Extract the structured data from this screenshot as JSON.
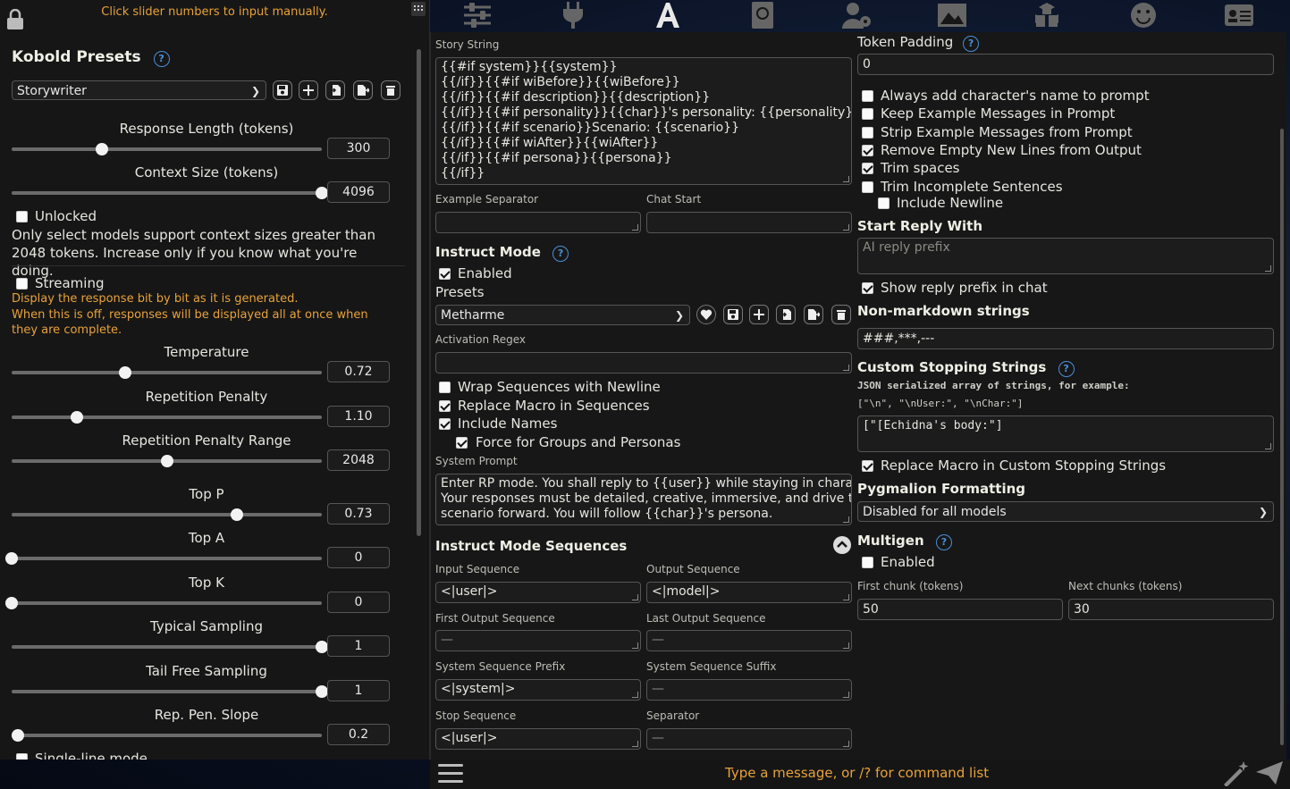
{
  "left": {
    "hint": "Click slider numbers to input manually.",
    "title": "Kobold Presets",
    "help": "?",
    "preset_select": "Storywriter",
    "sliders_top": [
      {
        "label": "Response Length (tokens)",
        "value": "300",
        "fraction": 0.29
      },
      {
        "label": "Context Size (tokens)",
        "value": "4096",
        "fraction": 1.0
      }
    ],
    "unlocked_label": "Unlocked",
    "unlocked_note": "Only select models support context sizes greater than 2048 tokens. Increase only if you know what you're doing.",
    "streaming_label": "Streaming",
    "streaming_note1": "Display the response bit by bit as it is generated.",
    "streaming_note2": "When this is off, responses will be displayed all at once when they are complete.",
    "sliders": [
      {
        "label": "Temperature",
        "value": "0.72",
        "fraction": 0.365
      },
      {
        "label": "Repetition Penalty",
        "value": "1.10",
        "fraction": 0.21
      },
      {
        "label": "Repetition Penalty Range",
        "value": "2048",
        "fraction": 0.5
      },
      {
        "label": "Top P",
        "value": "0.73",
        "fraction": 0.725
      },
      {
        "label": "Top A",
        "value": "0",
        "fraction": 0.0
      },
      {
        "label": "Top K",
        "value": "0",
        "fraction": 0.0
      },
      {
        "label": "Typical Sampling",
        "value": "1",
        "fraction": 1.0
      },
      {
        "label": "Tail Free Sampling",
        "value": "1",
        "fraction": 1.0
      },
      {
        "label": "Rep. Pen. Slope",
        "value": "0.2",
        "fraction": 0.02
      }
    ],
    "cut_label": "Single-line mode"
  },
  "main": {
    "story_string_label": "Story String",
    "story_string": "{{#if system}}{{system}}\n{{/if}}{{#if wiBefore}}{{wiBefore}}\n{{/if}}{{#if description}}{{description}}\n{{/if}}{{#if personality}}{{char}}'s personality: {{personality}}\n{{/if}}{{#if scenario}}Scenario: {{scenario}}\n{{/if}}{{#if wiAfter}}{{wiAfter}}\n{{/if}}{{#if persona}}{{persona}}\n{{/if}}",
    "example_separator_label": "Example Separator",
    "chat_start_label": "Chat Start",
    "instruct_title": "Instruct Mode",
    "enabled_label": "Enabled",
    "presets_label": "Presets",
    "instruct_preset": "Metharme",
    "activation_regex_label": "Activation Regex",
    "wrap_label": "Wrap Sequences with Newline",
    "replace_macro_label": "Replace Macro in Sequences",
    "include_names_label": "Include Names",
    "force_groups_label": "Force for Groups and Personas",
    "system_prompt_label": "System Prompt",
    "system_prompt": "Enter RP mode. You shall reply to {{user}} while staying in character.\nYour responses must be detailed, creative, immersive, and drive the\nscenario forward. You will follow {{char}}'s persona.",
    "sequences_title": "Instruct Mode Sequences",
    "input_seq_label": "Input Sequence",
    "input_seq": "<|user|>",
    "output_seq_label": "Output Sequence",
    "output_seq": "<|model|>",
    "first_output_label": "First Output Sequence",
    "first_output": "—",
    "last_output_label": "Last Output Sequence",
    "last_output": "—",
    "sys_prefix_label": "System Sequence Prefix",
    "sys_prefix": "<|system|>",
    "sys_suffix_label": "System Sequence Suffix",
    "sys_suffix": "—",
    "stop_seq_label": "Stop Sequence",
    "stop_seq": "<|user|>",
    "separator_label": "Separator",
    "separator": "—"
  },
  "right": {
    "token_padding_label": "Token Padding",
    "token_padding": "0",
    "opts": [
      {
        "label": "Always add character's name to prompt",
        "checked": false
      },
      {
        "label": "Keep Example Messages in Prompt",
        "checked": false
      },
      {
        "label": "Strip Example Messages from Prompt",
        "checked": false
      },
      {
        "label": "Remove Empty New Lines from Output",
        "checked": true
      },
      {
        "label": "Trim spaces",
        "checked": true
      },
      {
        "label": "Trim Incomplete Sentences",
        "checked": false
      }
    ],
    "include_newline_label": "Include Newline",
    "start_reply_title": "Start Reply With",
    "start_reply_placeholder": "AI reply prefix",
    "show_prefix_label": "Show reply prefix in chat",
    "nonmd_title": "Non-markdown strings",
    "nonmd_value": "###,***,---",
    "stop_strings_title": "Custom Stopping Strings",
    "stop_strings_note": "JSON serialized array of strings, for example:",
    "stop_strings_example": "[\"\\n\", \"\\nUser:\", \"\\nChar:\"]",
    "stop_strings_value": "[\"[Echidna's body:\"]",
    "replace_macro_stop_label": "Replace Macro in Custom Stopping Strings",
    "pyg_title": "Pygmalion Formatting",
    "pyg_value": "Disabled for all models",
    "multigen_title": "Multigen",
    "multigen_enabled": "Enabled",
    "first_chunk_label": "First chunk (tokens)",
    "first_chunk": "50",
    "next_chunks_label": "Next chunks (tokens)",
    "next_chunks": "30"
  },
  "bottom": {
    "placeholder": "Type a message, or /? for command list"
  }
}
